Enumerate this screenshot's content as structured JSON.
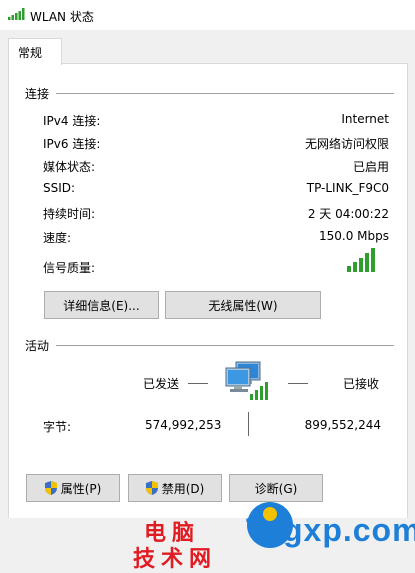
{
  "window": {
    "title": "WLAN 状态"
  },
  "tabs": [
    {
      "label": "常规"
    }
  ],
  "connection": {
    "section_title": "连接",
    "rows": [
      {
        "label": "IPv4 连接:",
        "value": "Internet"
      },
      {
        "label": "IPv6 连接:",
        "value": "无网络访问权限"
      },
      {
        "label": "媒体状态:",
        "value": "已启用"
      },
      {
        "label": "SSID:",
        "value": "TP-LINK_F9C0"
      },
      {
        "label": "持续时间:",
        "value": "2 天 04:00:22"
      },
      {
        "label": "速度:",
        "value": "150.0 Mbps"
      }
    ],
    "signal_label": "信号质量:",
    "signal_bars": 5,
    "details_button": "详细信息(E)...",
    "wireless_props_button": "无线属性(W)"
  },
  "activity": {
    "section_title": "活动",
    "sent_label": "已发送",
    "received_label": "已接收",
    "bytes_label": "字节:",
    "bytes_sent": "574,992,253",
    "bytes_received": "899,552,244"
  },
  "buttons": {
    "properties": "属性(P)",
    "disable": "禁用(D)",
    "diagnose": "诊断(G)"
  },
  "watermark": {
    "line1": "电脑",
    "line2": "技术网",
    "site": "Tagxp.com"
  },
  "colors": {
    "signal_green": "#2e9e2e",
    "watermark_red": "#e11b22",
    "watermark_blue": "#1e7fd9"
  }
}
